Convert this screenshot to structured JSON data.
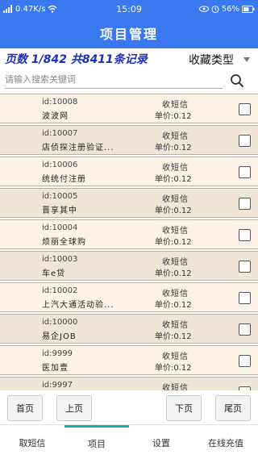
{
  "status_bar": {
    "speed": "0.47K/s",
    "time": "15:09",
    "battery": "56%"
  },
  "header": {
    "title": "项目管理"
  },
  "summary": {
    "page_info": "页数 1/842 共8411条记录",
    "type_select": "收藏类型"
  },
  "search": {
    "placeholder": "请输入搜索关键词"
  },
  "items": [
    {
      "id": "id:10008",
      "name": "波波网",
      "type": "收短信",
      "price": "单价:0.12"
    },
    {
      "id": "id:10007",
      "name": "店侦探注册验证...",
      "type": "收短信",
      "price": "单价:0.12"
    },
    {
      "id": "id:10006",
      "name": "统统付注册",
      "type": "收短信",
      "price": "单价:0.12"
    },
    {
      "id": "id:10005",
      "name": "晋享其中",
      "type": "收短信",
      "price": "单价:0.12"
    },
    {
      "id": "id:10004",
      "name": "烦丽全球购",
      "type": "收短信",
      "price": "单价:0.12"
    },
    {
      "id": "id:10003",
      "name": "车e贷",
      "type": "收短信",
      "price": "单价:0.12"
    },
    {
      "id": "id:10002",
      "name": "上汽大通活动验...",
      "type": "收短信",
      "price": "单价:0.12"
    },
    {
      "id": "id:10000",
      "name": "易企JOB",
      "type": "收短信",
      "price": "单价:0.12"
    },
    {
      "id": "id:9999",
      "name": "医加壹",
      "type": "收短信",
      "price": "单价:0.12"
    },
    {
      "id": "id:9997",
      "name": "",
      "type": "收短信",
      "price": ""
    }
  ],
  "pager": {
    "first": "首页",
    "prev": "上页",
    "next": "下页",
    "last": "尾页"
  },
  "tabs": [
    "取短信",
    "项目",
    "设置",
    "在线充值"
  ],
  "colors": {
    "header_bg": "#3a78f0",
    "row_light": "#fcf3e6",
    "row_dark": "#efe6d8",
    "page_info": "#1c2fc0",
    "active_tab": "#16a9b6"
  }
}
